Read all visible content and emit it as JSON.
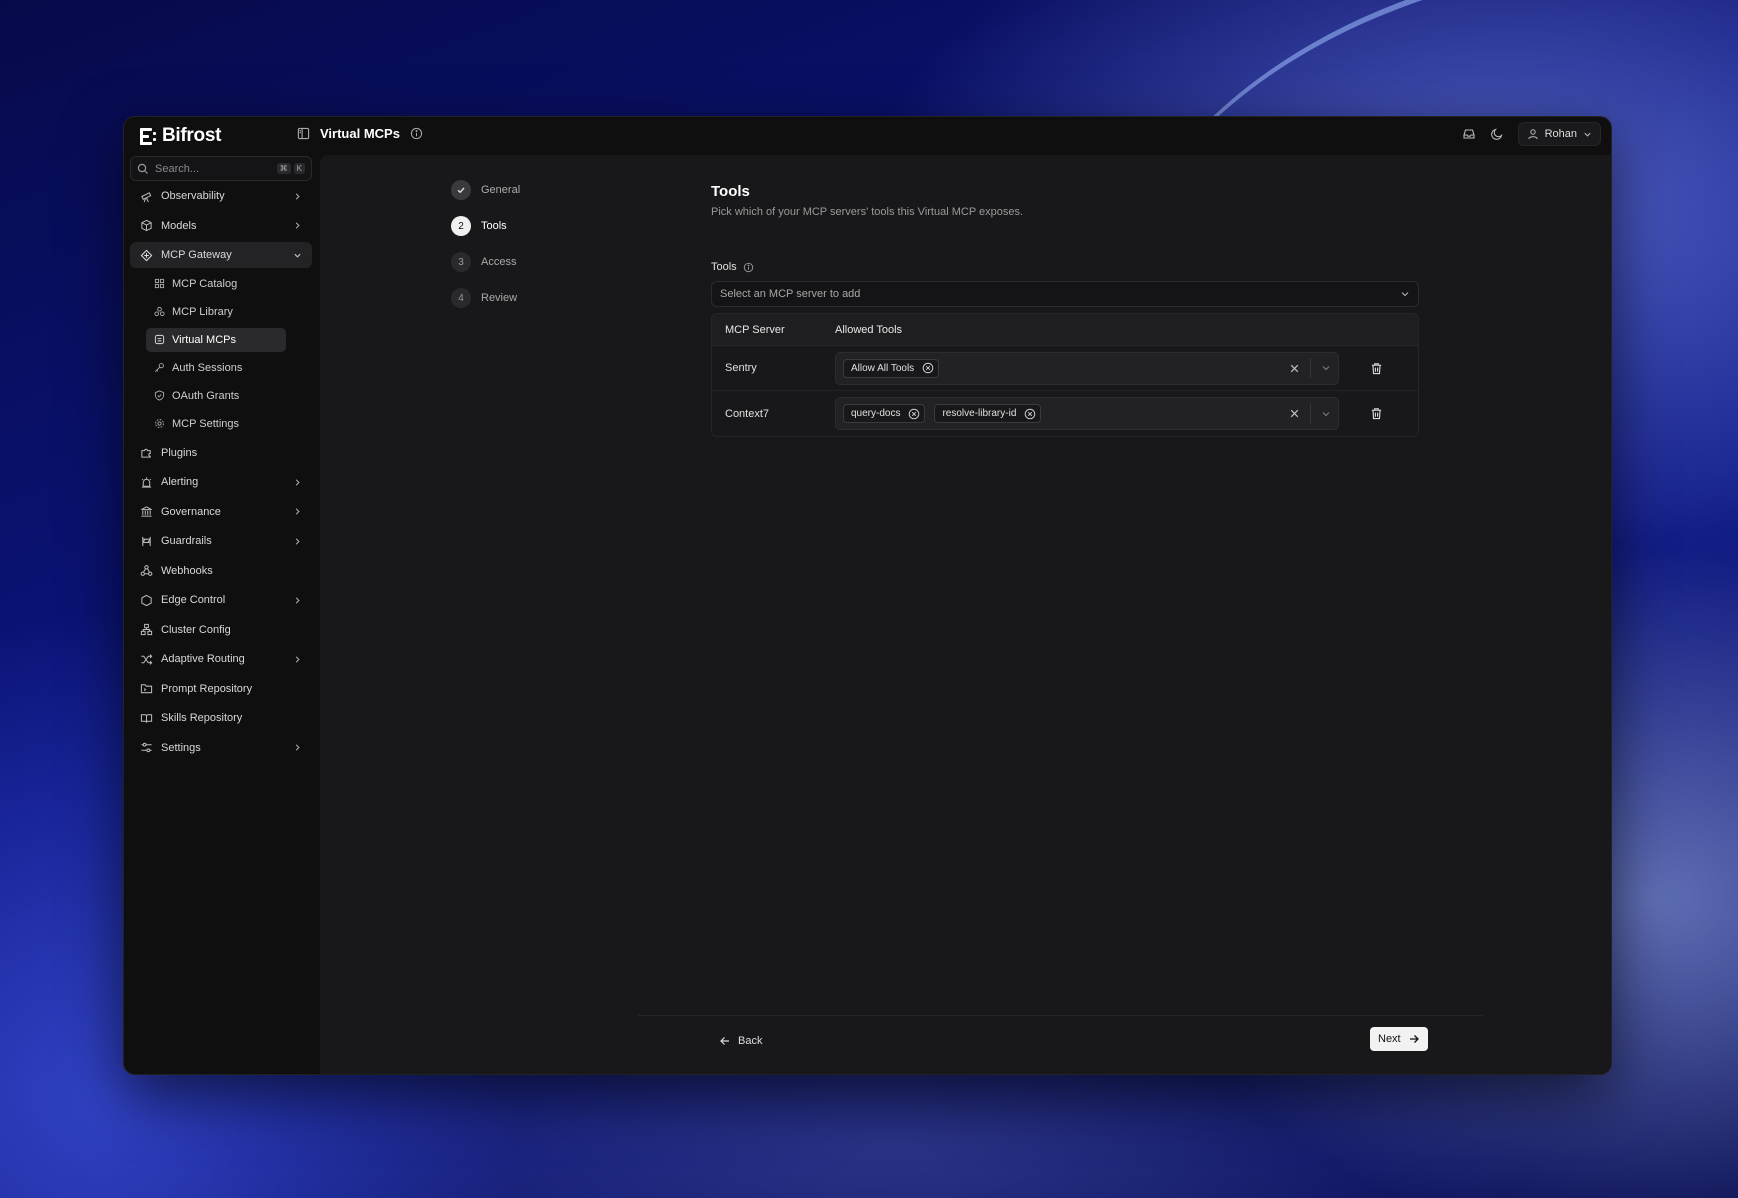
{
  "app": {
    "name": "Bifrost"
  },
  "header": {
    "title": "Virtual MCPs",
    "user": "Rohan"
  },
  "search": {
    "placeholder": "Search...",
    "shortcut": [
      "⌘",
      "K"
    ]
  },
  "sidebar": {
    "items": [
      {
        "label": "Observability",
        "icon": "telescope-icon"
      },
      {
        "label": "Models",
        "icon": "cube-icon"
      },
      {
        "label": "MCP Gateway",
        "icon": "gateway-icon"
      },
      {
        "label": "Plugins",
        "icon": "puzzle-icon"
      },
      {
        "label": "Alerting",
        "icon": "siren-icon"
      },
      {
        "label": "Governance",
        "icon": "landmark-icon"
      },
      {
        "label": "Guardrails",
        "icon": "guardrail-icon"
      },
      {
        "label": "Webhooks",
        "icon": "webhook-icon"
      },
      {
        "label": "Edge Control",
        "icon": "hexagon-icon"
      },
      {
        "label": "Cluster Config",
        "icon": "network-icon"
      },
      {
        "label": "Adaptive Routing",
        "icon": "shuffle-icon"
      },
      {
        "label": "Prompt Repository",
        "icon": "folder-icon"
      },
      {
        "label": "Skills Repository",
        "icon": "book-icon"
      },
      {
        "label": "Settings",
        "icon": "sliders-icon"
      }
    ],
    "mcp_sub": [
      {
        "label": "MCP Catalog"
      },
      {
        "label": "MCP Library"
      },
      {
        "label": "Virtual MCPs"
      },
      {
        "label": "Auth Sessions"
      },
      {
        "label": "OAuth Grants"
      },
      {
        "label": "MCP Settings"
      }
    ]
  },
  "stepper": {
    "steps": [
      {
        "num": "1",
        "label": "General"
      },
      {
        "num": "2",
        "label": "Tools"
      },
      {
        "num": "3",
        "label": "Access"
      },
      {
        "num": "4",
        "label": "Review"
      }
    ]
  },
  "form": {
    "title": "Tools",
    "description": "Pick which of your MCP servers' tools this Virtual MCP exposes.",
    "tools_label": "Tools",
    "select_placeholder": "Select an MCP server to add",
    "table": {
      "headers": [
        "MCP Server",
        "Allowed Tools"
      ],
      "rows": [
        {
          "server": "Sentry",
          "tools": [
            "Allow All Tools"
          ]
        },
        {
          "server": "Context7",
          "tools": [
            "query-docs",
            "resolve-library-id"
          ]
        }
      ]
    }
  },
  "footer": {
    "back": "Back",
    "next": "Next"
  },
  "colors": {
    "background": "#18181a",
    "sidebar": "#0f0f10",
    "accent": "#f2f2f2"
  }
}
